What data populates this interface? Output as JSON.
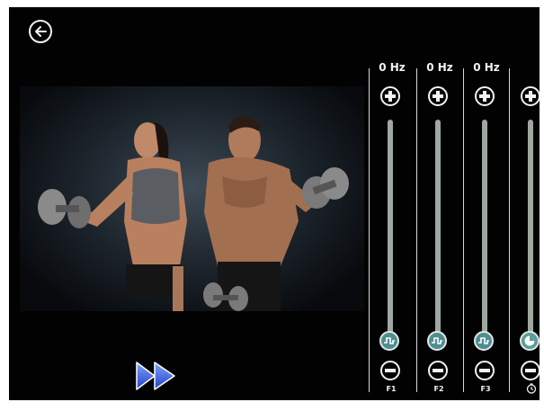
{
  "screen": {
    "back_icon": "arrow-left-circle-icon",
    "photo_icon": "fitness-couple-photo",
    "play_icon": "fast-forward-icon"
  },
  "equalizer": {
    "channels": [
      {
        "freq": "0 Hz",
        "label": "F1",
        "level": 0.0,
        "knob_icon": "square-wave-icon"
      },
      {
        "freq": "0 Hz",
        "label": "F2",
        "level": 0.0,
        "knob_icon": "square-wave-icon"
      },
      {
        "freq": "0 Hz",
        "label": "F3",
        "level": 0.0,
        "knob_icon": "square-wave-icon"
      },
      {
        "freq": "",
        "label": "",
        "level": 0.0,
        "knob_icon": "pie-icon",
        "label_icon": "timer-icon"
      }
    ]
  },
  "colors": {
    "background": "#020202",
    "knob": "#4f8e90",
    "play": "#3b5fe0",
    "text": "#f2f2f2"
  }
}
